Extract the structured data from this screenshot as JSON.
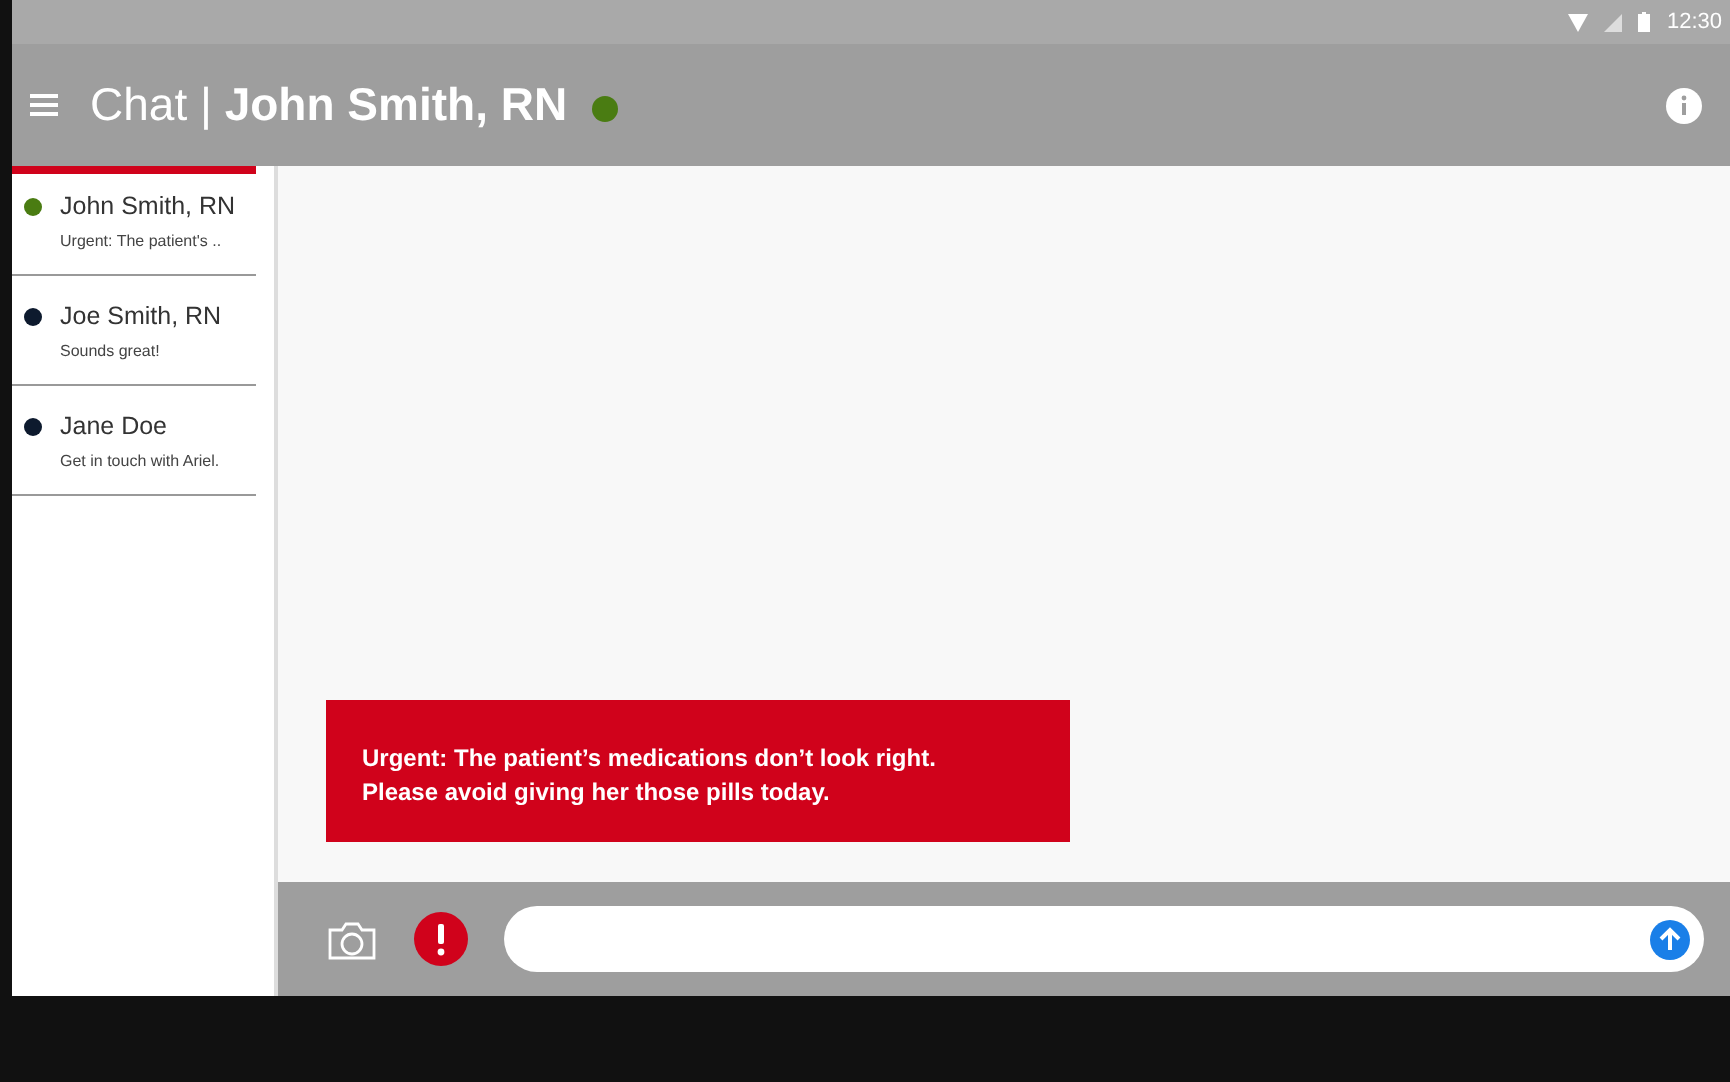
{
  "status_bar": {
    "time": "12:30"
  },
  "header": {
    "title": "Chat | **John Smith, RN**",
    "color": "#4a7c12"
  },
  "contacts": [
    {
      "name": "John Smith, RN",
      "preview": "Urgent: The patient's ..",
      "color": "#4a7c12",
      "selected": true
    },
    {
      "name": "Joe Smith, RN",
      "preview": "Sounds great!",
      "color": "#0d1a2e",
      "selected": false
    },
    {
      "name": "Jane Doe",
      "preview": "Get in touch with Ariel.",
      "color": "#0d1a2e",
      "selected": false
    }
  ],
  "messages": [
    {
      "kind": "urgent",
      "text": "Urgent: The patient’s medications don’t look right.\nPlease avoid giving her those pills today."
    }
  ]
}
